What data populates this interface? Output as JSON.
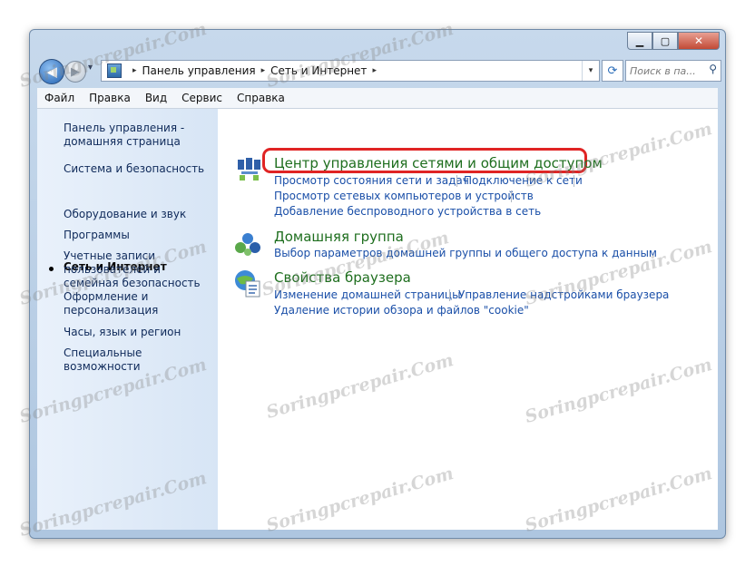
{
  "window": {
    "controls": {
      "minimize": "▁",
      "maximize": "▢",
      "close": "✕"
    }
  },
  "nav": {
    "back": "◀",
    "forward": "▶",
    "history": "▾",
    "breadcrumb": [
      "Панель управления",
      "Сеть и Интернет"
    ],
    "separator": "▸",
    "dropdown": "▾",
    "refresh": "⟳",
    "search_placeholder": "Поиск в па...",
    "search_icon": "⚲"
  },
  "menu": [
    "Файл",
    "Правка",
    "Вид",
    "Сервис",
    "Справка"
  ],
  "sidebar": {
    "items": [
      {
        "label": "Панель управления - домашняя страница",
        "current": false
      },
      {
        "label": "Система и безопасность",
        "current": false
      },
      {
        "label": "Сеть и Интернет",
        "current": true
      },
      {
        "label": "Оборудование и звук",
        "current": false
      },
      {
        "label": "Программы",
        "current": false
      },
      {
        "label": "Учетные записи пользователей и семейная безопасность",
        "current": false
      },
      {
        "label": "Оформление и персонализация",
        "current": false
      },
      {
        "label": "Часы, язык и регион",
        "current": false
      },
      {
        "label": "Специальные возможности",
        "current": false
      }
    ]
  },
  "categories": [
    {
      "title": "Центр управления сетями и общим доступом",
      "icon": "network-center-icon",
      "links": [
        "Просмотр состояния сети и задач",
        "Подключение к сети",
        "Просмотр сетевых компьютеров и устройств",
        "Добавление беспроводного устройства в сеть"
      ]
    },
    {
      "title": "Домашняя группа",
      "icon": "homegroup-icon",
      "links": [
        "Выбор параметров домашней группы и общего доступа к данным"
      ]
    },
    {
      "title": "Свойства браузера",
      "icon": "internet-options-icon",
      "links": [
        "Изменение домашней страницы",
        "Управление надстройками браузера",
        "Удаление истории обзора и файлов \"cookie\""
      ]
    }
  ],
  "watermark": "Soringpcrepair.Com",
  "colors": {
    "category_title": "#1e6e1e",
    "link": "#1a4fa8",
    "highlight": "#e02424"
  }
}
